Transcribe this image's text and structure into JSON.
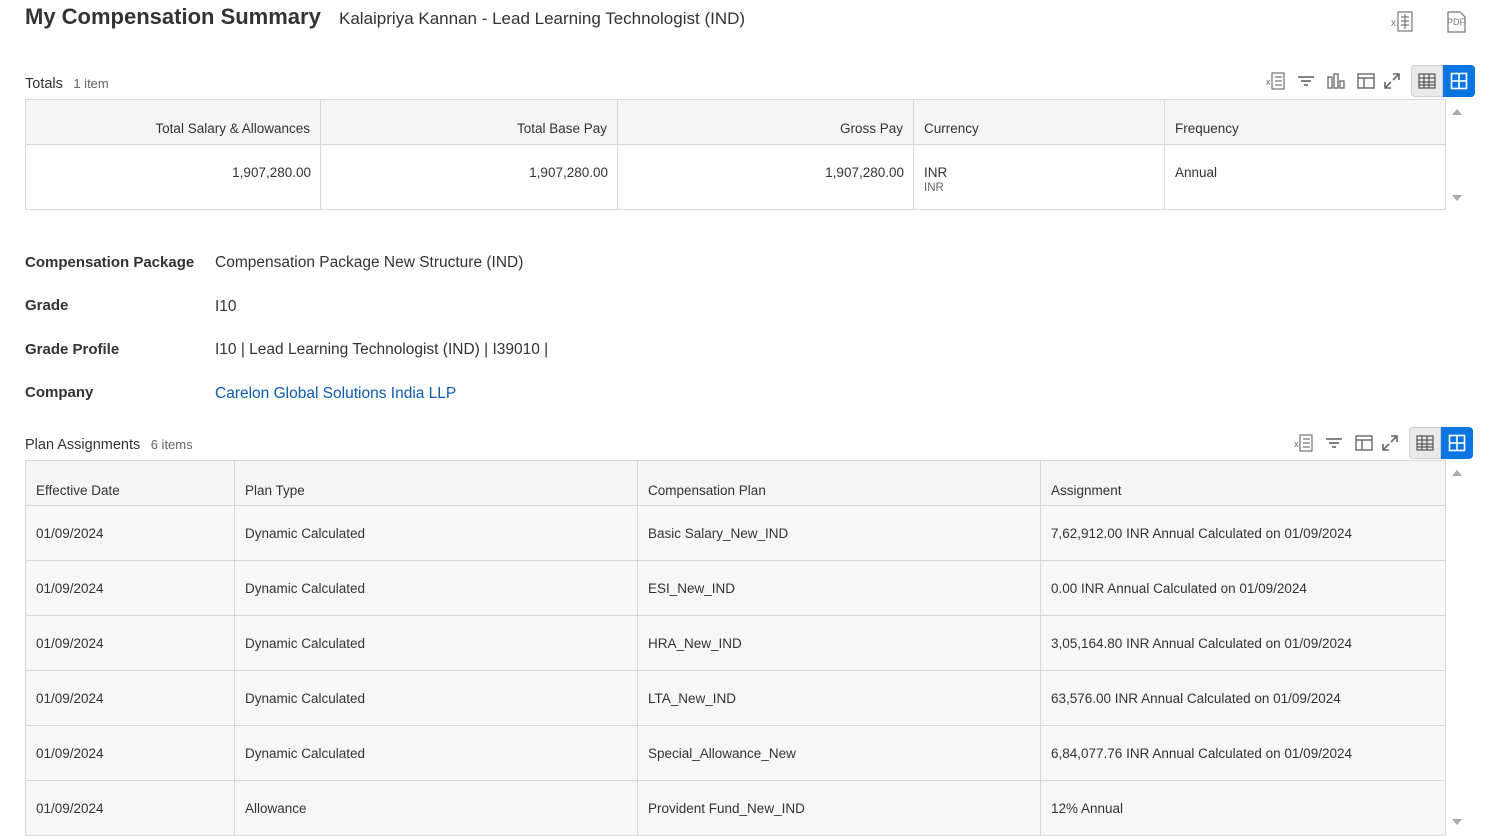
{
  "header": {
    "title": "My Compensation Summary",
    "subtitle": "Kalaipriya Kannan - Lead Learning Technologist (IND)",
    "excel_icon": "excel-export-icon",
    "pdf_label": "PDF"
  },
  "totals": {
    "title": "Totals",
    "count": "1 item",
    "columns": [
      "Total Salary & Allowances",
      "Total Base Pay",
      "Gross Pay",
      "Currency",
      "Frequency"
    ],
    "row": {
      "total_salary": "1,907,280.00",
      "total_base_pay": "1,907,280.00",
      "gross_pay": "1,907,280.00",
      "currency": "INR",
      "currency_sub": "INR",
      "frequency": "Annual"
    }
  },
  "details": {
    "package_label": "Compensation Package",
    "package_value": "Compensation Package New Structure (IND)",
    "grade_label": "Grade",
    "grade_value": "I10",
    "grade_profile_label": "Grade Profile",
    "grade_profile_value": "I10 | Lead Learning Technologist (IND) | I39010 |",
    "company_label": "Company",
    "company_value": "Carelon Global Solutions India LLP"
  },
  "plans": {
    "title": "Plan Assignments",
    "count": "6 items",
    "columns": [
      "Effective Date",
      "Plan Type",
      "Compensation Plan",
      "Assignment"
    ],
    "rows": [
      {
        "date": "01/09/2024",
        "type": "Dynamic Calculated",
        "plan": "Basic Salary_New_IND",
        "assignment": "7,62,912.00 INR Annual  Calculated on 01/09/2024"
      },
      {
        "date": "01/09/2024",
        "type": "Dynamic Calculated",
        "plan": "ESI_New_IND",
        "assignment": "0.00 INR Annual  Calculated on 01/09/2024"
      },
      {
        "date": "01/09/2024",
        "type": "Dynamic Calculated",
        "plan": "HRA_New_IND",
        "assignment": "3,05,164.80 INR Annual  Calculated on 01/09/2024"
      },
      {
        "date": "01/09/2024",
        "type": "Dynamic Calculated",
        "plan": "LTA_New_IND",
        "assignment": "63,576.00 INR Annual  Calculated on 01/09/2024"
      },
      {
        "date": "01/09/2024",
        "type": "Dynamic Calculated",
        "plan": "Special_Allowance_New",
        "assignment": "6,84,077.76 INR Annual  Calculated on 01/09/2024"
      },
      {
        "date": "01/09/2024",
        "type": "Allowance",
        "plan": "Provident Fund_New_IND",
        "assignment": "12% Annual"
      }
    ]
  },
  "colors": {
    "accent": "#0875e1",
    "link": "#0b5cad",
    "header_bg": "#f5f5f5"
  }
}
